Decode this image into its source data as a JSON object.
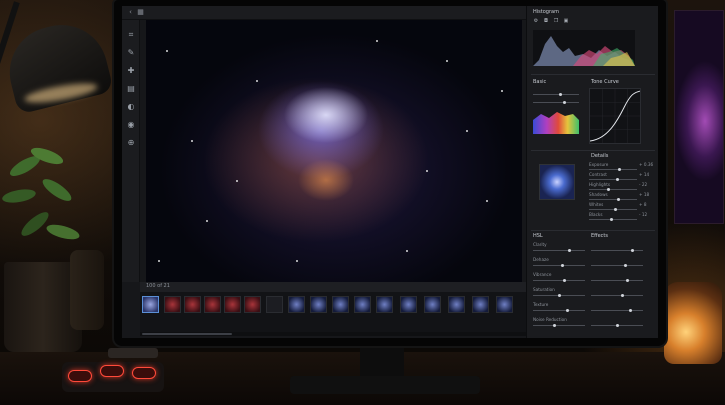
{
  "app": {
    "panels": {
      "histogram_title": "Histogram",
      "basic_title": "Basic",
      "curves_title": "Tone Curve",
      "color_title": "HSL",
      "details_title": "Details",
      "effects_title": "Effects"
    },
    "filmstrip_label": "100 of 21",
    "sliders_right_top": [
      {
        "label": "Exposure",
        "value": "+ 0.36",
        "level": 0.62
      },
      {
        "label": "Contrast",
        "value": "+ 14",
        "level": 0.58
      },
      {
        "label": "Highlights",
        "value": "- 22",
        "level": 0.4
      },
      {
        "label": "Shadows",
        "value": "+ 18",
        "level": 0.6
      },
      {
        "label": "Whites",
        "value": "+ 8",
        "level": 0.55
      },
      {
        "label": "Blacks",
        "value": "- 12",
        "level": 0.45
      }
    ],
    "sliders_left_bottom": [
      {
        "label": "Clarity",
        "level": 0.7
      },
      {
        "label": "Dehaze",
        "level": 0.55
      },
      {
        "label": "Vibrance",
        "level": 0.6
      },
      {
        "label": "Saturation",
        "level": 0.5
      },
      {
        "label": "Texture",
        "level": 0.65
      },
      {
        "label": "Noise Reduction",
        "level": 0.4
      }
    ]
  },
  "colors": {
    "accent": "#5b8fd6",
    "panel_bg": "#1a1b1e",
    "canvas_bg": "#05060d"
  },
  "icons": [
    "crop-icon",
    "brush-icon",
    "heal-icon",
    "gradient-icon",
    "mask-icon",
    "eye-icon",
    "zoom-icon",
    "gear-icon"
  ]
}
